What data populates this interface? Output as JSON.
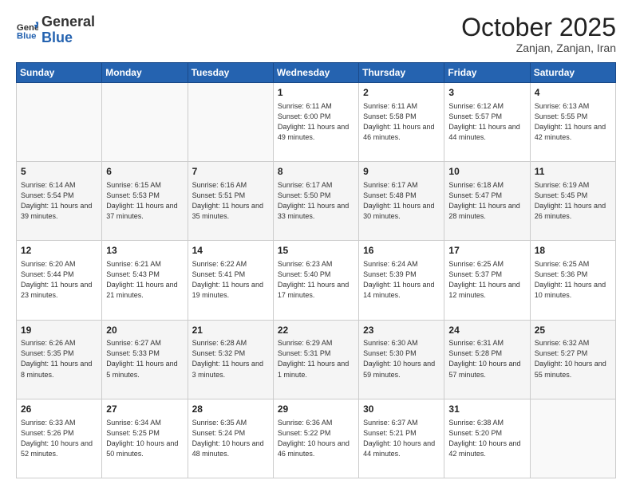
{
  "header": {
    "logo_general": "General",
    "logo_blue": "Blue",
    "month_title": "October 2025",
    "location": "Zanjan, Zanjan, Iran"
  },
  "calendar": {
    "days_of_week": [
      "Sunday",
      "Monday",
      "Tuesday",
      "Wednesday",
      "Thursday",
      "Friday",
      "Saturday"
    ],
    "weeks": [
      [
        {
          "day": "",
          "info": ""
        },
        {
          "day": "",
          "info": ""
        },
        {
          "day": "",
          "info": ""
        },
        {
          "day": "1",
          "info": "Sunrise: 6:11 AM\nSunset: 6:00 PM\nDaylight: 11 hours\nand 49 minutes."
        },
        {
          "day": "2",
          "info": "Sunrise: 6:11 AM\nSunset: 5:58 PM\nDaylight: 11 hours\nand 46 minutes."
        },
        {
          "day": "3",
          "info": "Sunrise: 6:12 AM\nSunset: 5:57 PM\nDaylight: 11 hours\nand 44 minutes."
        },
        {
          "day": "4",
          "info": "Sunrise: 6:13 AM\nSunset: 5:55 PM\nDaylight: 11 hours\nand 42 minutes."
        }
      ],
      [
        {
          "day": "5",
          "info": "Sunrise: 6:14 AM\nSunset: 5:54 PM\nDaylight: 11 hours\nand 39 minutes."
        },
        {
          "day": "6",
          "info": "Sunrise: 6:15 AM\nSunset: 5:53 PM\nDaylight: 11 hours\nand 37 minutes."
        },
        {
          "day": "7",
          "info": "Sunrise: 6:16 AM\nSunset: 5:51 PM\nDaylight: 11 hours\nand 35 minutes."
        },
        {
          "day": "8",
          "info": "Sunrise: 6:17 AM\nSunset: 5:50 PM\nDaylight: 11 hours\nand 33 minutes."
        },
        {
          "day": "9",
          "info": "Sunrise: 6:17 AM\nSunset: 5:48 PM\nDaylight: 11 hours\nand 30 minutes."
        },
        {
          "day": "10",
          "info": "Sunrise: 6:18 AM\nSunset: 5:47 PM\nDaylight: 11 hours\nand 28 minutes."
        },
        {
          "day": "11",
          "info": "Sunrise: 6:19 AM\nSunset: 5:45 PM\nDaylight: 11 hours\nand 26 minutes."
        }
      ],
      [
        {
          "day": "12",
          "info": "Sunrise: 6:20 AM\nSunset: 5:44 PM\nDaylight: 11 hours\nand 23 minutes."
        },
        {
          "day": "13",
          "info": "Sunrise: 6:21 AM\nSunset: 5:43 PM\nDaylight: 11 hours\nand 21 minutes."
        },
        {
          "day": "14",
          "info": "Sunrise: 6:22 AM\nSunset: 5:41 PM\nDaylight: 11 hours\nand 19 minutes."
        },
        {
          "day": "15",
          "info": "Sunrise: 6:23 AM\nSunset: 5:40 PM\nDaylight: 11 hours\nand 17 minutes."
        },
        {
          "day": "16",
          "info": "Sunrise: 6:24 AM\nSunset: 5:39 PM\nDaylight: 11 hours\nand 14 minutes."
        },
        {
          "day": "17",
          "info": "Sunrise: 6:25 AM\nSunset: 5:37 PM\nDaylight: 11 hours\nand 12 minutes."
        },
        {
          "day": "18",
          "info": "Sunrise: 6:25 AM\nSunset: 5:36 PM\nDaylight: 11 hours\nand 10 minutes."
        }
      ],
      [
        {
          "day": "19",
          "info": "Sunrise: 6:26 AM\nSunset: 5:35 PM\nDaylight: 11 hours\nand 8 minutes."
        },
        {
          "day": "20",
          "info": "Sunrise: 6:27 AM\nSunset: 5:33 PM\nDaylight: 11 hours\nand 5 minutes."
        },
        {
          "day": "21",
          "info": "Sunrise: 6:28 AM\nSunset: 5:32 PM\nDaylight: 11 hours\nand 3 minutes."
        },
        {
          "day": "22",
          "info": "Sunrise: 6:29 AM\nSunset: 5:31 PM\nDaylight: 11 hours\nand 1 minute."
        },
        {
          "day": "23",
          "info": "Sunrise: 6:30 AM\nSunset: 5:30 PM\nDaylight: 10 hours\nand 59 minutes."
        },
        {
          "day": "24",
          "info": "Sunrise: 6:31 AM\nSunset: 5:28 PM\nDaylight: 10 hours\nand 57 minutes."
        },
        {
          "day": "25",
          "info": "Sunrise: 6:32 AM\nSunset: 5:27 PM\nDaylight: 10 hours\nand 55 minutes."
        }
      ],
      [
        {
          "day": "26",
          "info": "Sunrise: 6:33 AM\nSunset: 5:26 PM\nDaylight: 10 hours\nand 52 minutes."
        },
        {
          "day": "27",
          "info": "Sunrise: 6:34 AM\nSunset: 5:25 PM\nDaylight: 10 hours\nand 50 minutes."
        },
        {
          "day": "28",
          "info": "Sunrise: 6:35 AM\nSunset: 5:24 PM\nDaylight: 10 hours\nand 48 minutes."
        },
        {
          "day": "29",
          "info": "Sunrise: 6:36 AM\nSunset: 5:22 PM\nDaylight: 10 hours\nand 46 minutes."
        },
        {
          "day": "30",
          "info": "Sunrise: 6:37 AM\nSunset: 5:21 PM\nDaylight: 10 hours\nand 44 minutes."
        },
        {
          "day": "31",
          "info": "Sunrise: 6:38 AM\nSunset: 5:20 PM\nDaylight: 10 hours\nand 42 minutes."
        },
        {
          "day": "",
          "info": ""
        }
      ]
    ]
  }
}
